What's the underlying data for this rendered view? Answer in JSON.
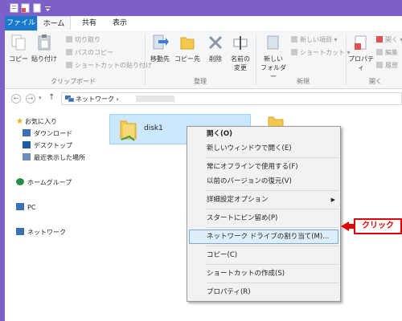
{
  "ribbon": {
    "tabs": [
      {
        "label": "ファイル"
      },
      {
        "label": "ホーム"
      },
      {
        "label": "共有"
      },
      {
        "label": "表示"
      }
    ],
    "clipboard": {
      "copy": "コピー",
      "paste": "貼り付け",
      "cut": "切り取り",
      "copy_path": "パスのコピー",
      "paste_shortcut": "ショートカットの貼り付け",
      "group": "クリップボード"
    },
    "organize": {
      "move_to": "移動先",
      "copy_to": "コピー先",
      "delete": "削除",
      "rename_line1": "名前の",
      "rename_line2": "変更",
      "group": "整理"
    },
    "new": {
      "new_folder_line1": "新しい",
      "new_folder_line2": "フォルダー",
      "new_item": "新しい項目 ▾",
      "shortcut": "ショートカット ▾",
      "group": "新規"
    },
    "open": {
      "properties": "プロパティ",
      "open_btn": "開く ▾",
      "edit": "編集",
      "history": "履歴",
      "group": "開く"
    }
  },
  "address": {
    "back": "←",
    "forward": "→",
    "up": "↑",
    "path": "ネットワーク ›"
  },
  "nav": {
    "favorites": "お気に入り",
    "downloads": "ダウンロード",
    "desktop": "デスクトップ",
    "recent": "最近表示した場所",
    "homegroup": "ホームグループ",
    "pc": "PC",
    "network": "ネットワーク"
  },
  "content": {
    "item_name": "disk1"
  },
  "context_menu": {
    "items": [
      {
        "label": "開く(O)"
      },
      {
        "label": "新しいウィンドウで開く(E)"
      },
      {
        "label": "常にオフラインで使用する(F)"
      },
      {
        "label": "以前のバージョンの復元(V)"
      },
      {
        "label": "詳細設定オプション"
      },
      {
        "label": "スタートにピン留め(P)"
      },
      {
        "label": "ネットワーク ドライブの割り当て(M)..."
      },
      {
        "label": "コピー(C)"
      },
      {
        "label": "ショートカットの作成(S)"
      },
      {
        "label": "プロパティ(R)"
      }
    ]
  },
  "annotation": {
    "callout": "クリック"
  },
  "colors": {
    "titlebar": "#7c5fc9",
    "file_tab": "#1979ca",
    "selection": "#cce8ff",
    "callout": "#e00000"
  }
}
